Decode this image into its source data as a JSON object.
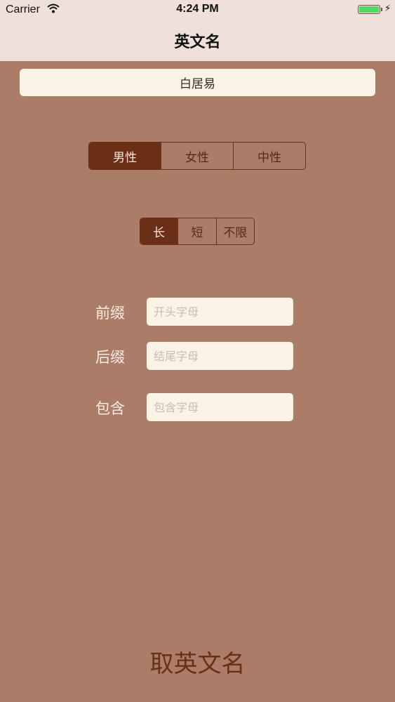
{
  "status_bar": {
    "carrier": "Carrier",
    "time": "4:24 PM",
    "battery_level": 1.0
  },
  "nav": {
    "title": "英文名"
  },
  "result": {
    "name": "白居易"
  },
  "gender": {
    "options": [
      "男性",
      "女性",
      "中性"
    ],
    "selected": "男性"
  },
  "length": {
    "options": [
      "长",
      "短",
      "不限"
    ],
    "selected": "长"
  },
  "form": {
    "prefix": {
      "label": "前缀",
      "placeholder": "开头字母",
      "value": ""
    },
    "suffix": {
      "label": "后缀",
      "placeholder": "结尾字母",
      "value": ""
    },
    "contains": {
      "label": "包含",
      "placeholder": "包含字母",
      "value": ""
    }
  },
  "submit_label": "取英文名",
  "colors": {
    "background": "#ab7d69",
    "header": "#efe1d9",
    "accent": "#6b2f17",
    "field": "#f8f3e4"
  },
  "icons": [
    "wifi-icon",
    "battery-icon",
    "charging-bolt-icon"
  ]
}
